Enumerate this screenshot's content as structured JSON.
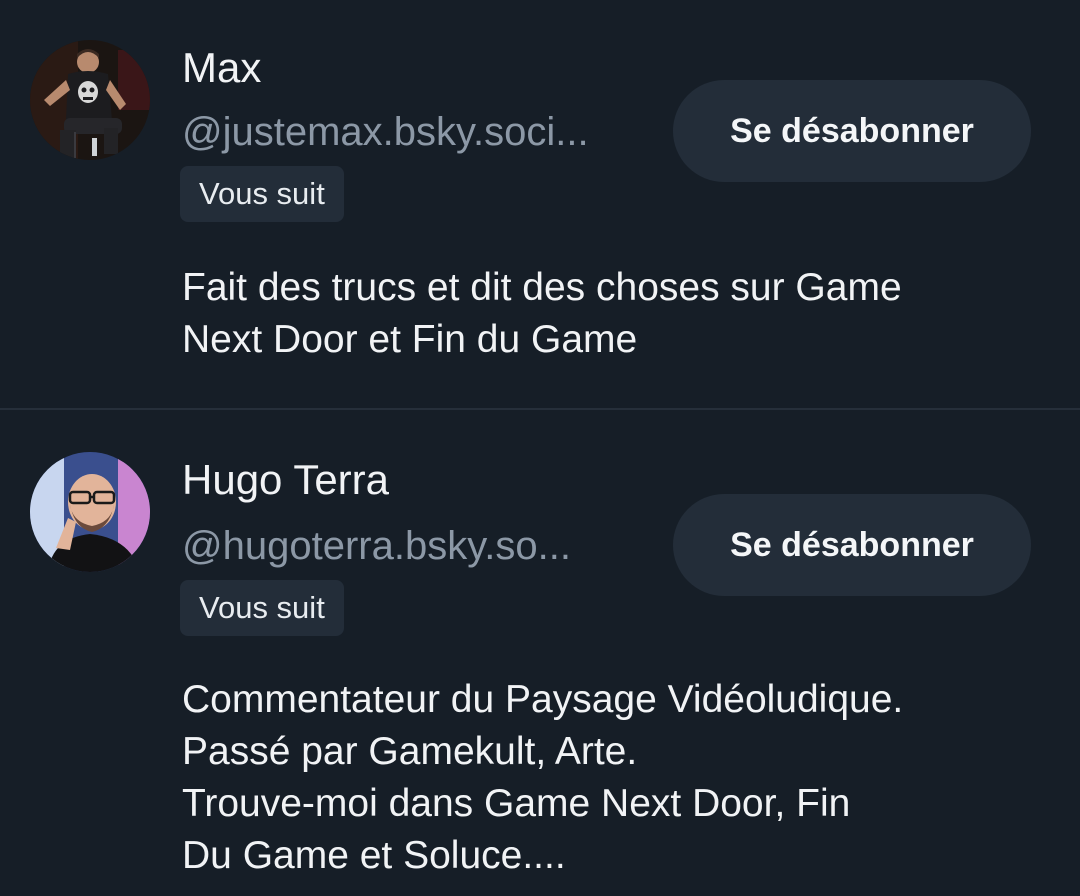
{
  "profiles": [
    {
      "display_name": "Max",
      "handle": "@justemax.bsky.soci...",
      "badge": "Vous suit",
      "button_label": "Se désabonner",
      "bio": "Fait des trucs et dit des choses sur Game\nNext Door et Fin du Game"
    },
    {
      "display_name": "Hugo Terra",
      "handle": "@hugoterra.bsky.so...",
      "badge": "Vous suit",
      "button_label": "Se désabonner",
      "bio": "Commentateur du Paysage Vidéoludique.\nPassé par Gamekult, Arte.\nTrouve-moi dans Game Next Door, Fin\nDu Game et Soluce...."
    }
  ],
  "colors": {
    "background": "#161e27",
    "surface": "#232d39",
    "divider": "#262f3a",
    "text_primary": "#f1f3f5",
    "text_secondary": "#8c98a6"
  }
}
